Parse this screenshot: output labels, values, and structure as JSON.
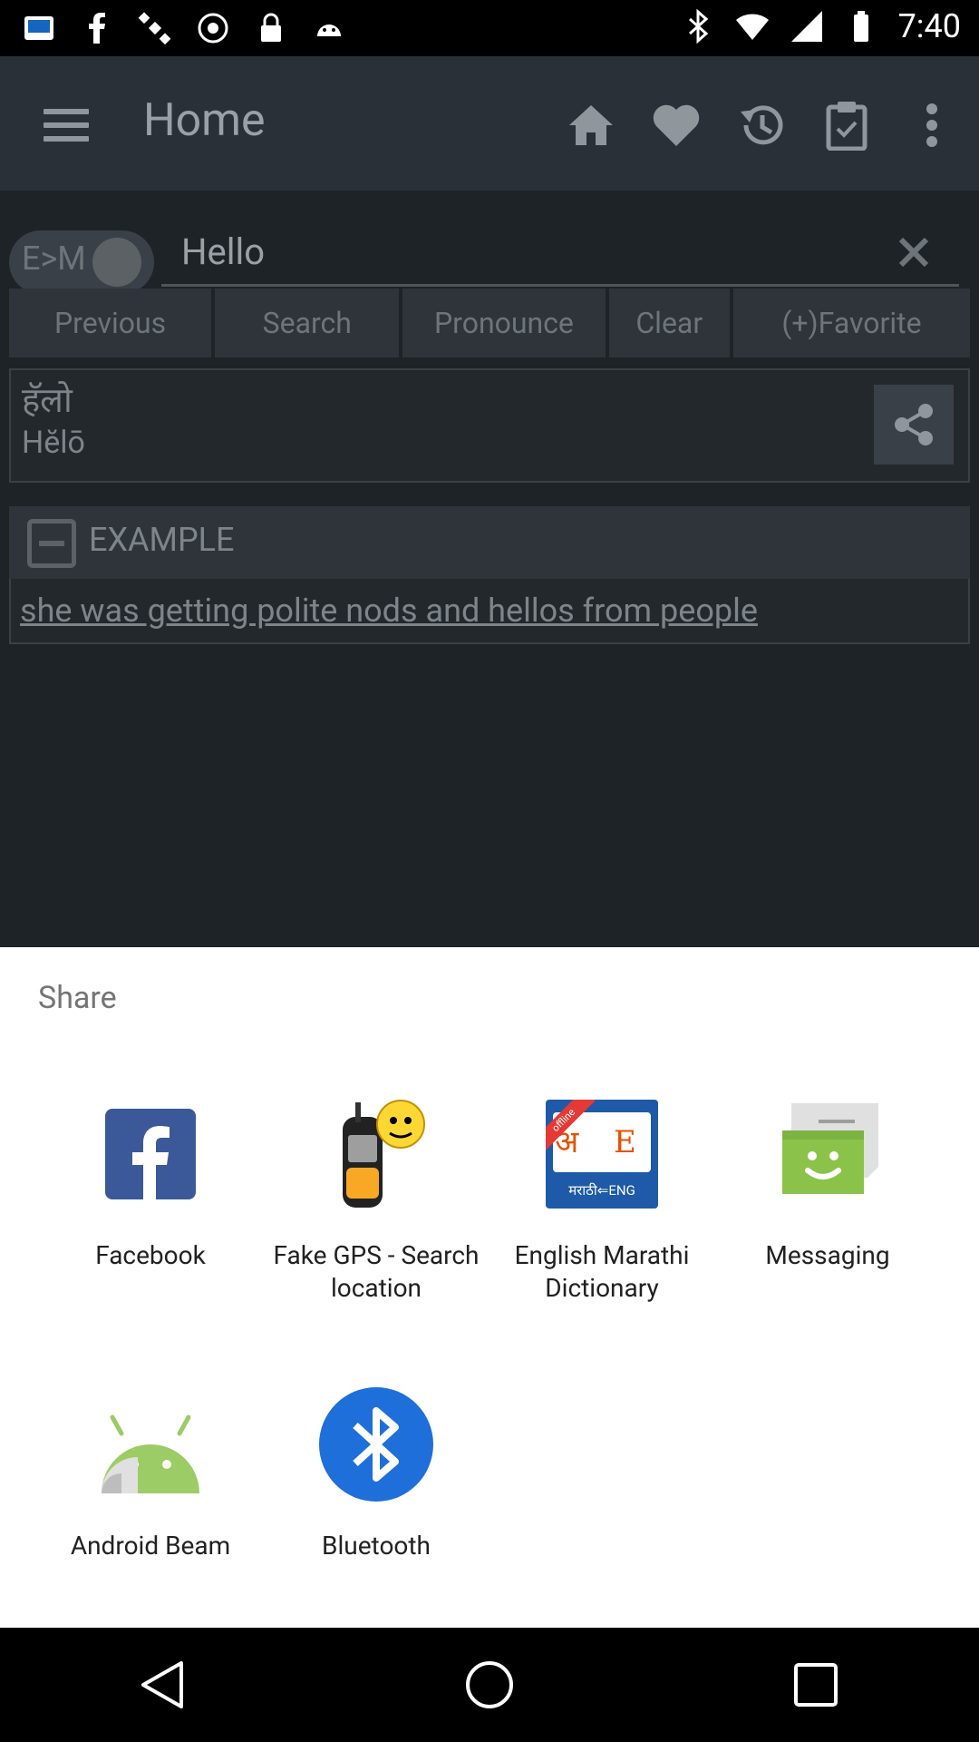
{
  "status_bar": {
    "time": "7:40"
  },
  "app": {
    "title": "Home",
    "toggle_label": "E>M",
    "search_value": "Hello",
    "buttons": [
      "Previous",
      "Search",
      "Pronounce",
      "Clear",
      "(+)Favorite"
    ],
    "result": {
      "hindi": "हॅलो",
      "transliteration": "Hĕlō"
    },
    "example_label": "EXAMPLE",
    "example_sentence": "she was getting polite nods and hellos from people"
  },
  "share_sheet": {
    "title": "Share",
    "targets": [
      {
        "label": "Facebook",
        "icon": "facebook-icon"
      },
      {
        "label": "Fake GPS - Search location",
        "icon": "gps-device-icon"
      },
      {
        "label": "English Marathi Dictionary",
        "icon": "dictionary-book-icon",
        "badge": "offline"
      },
      {
        "label": "Messaging",
        "icon": "messaging-icon"
      },
      {
        "label": "Android Beam",
        "icon": "android-beam-icon"
      },
      {
        "label": "Bluetooth",
        "icon": "bluetooth-icon"
      }
    ],
    "dictionary_icon_text": {
      "top": "अ E",
      "bottom": "मराठी⇐ENG"
    }
  },
  "colors": {
    "facebook_blue": "#3b5998",
    "bluetooth_blue": "#1565c0",
    "messaging_green": "#8bc34a",
    "android_green": "#9ccc65"
  }
}
